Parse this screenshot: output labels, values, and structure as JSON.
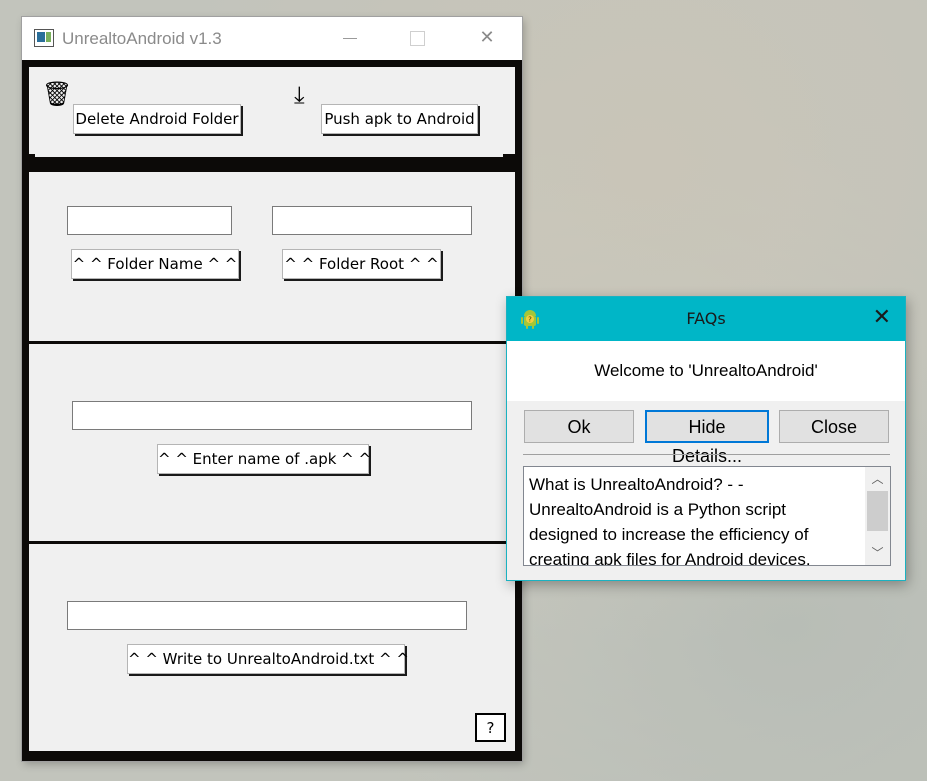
{
  "main_window": {
    "title": "UnrealtoAndroid v1.3",
    "controls": {
      "minimize": "",
      "maximize": "",
      "close": "✕"
    },
    "top_panel": {
      "delete_icon": "🗑",
      "delete_button": "Delete Android Folder",
      "download_icon": "⤓",
      "push_button": "Push apk to Android"
    },
    "folder_panel": {
      "folder_name_value": "",
      "folder_root_value": "",
      "folder_name_button": "^ ^ Folder Name ^ ^",
      "folder_root_button": "^ ^ Folder Root ^ ^"
    },
    "apk_panel": {
      "apk_name_value": "",
      "apk_button": "^ ^ Enter name of .apk ^ ^"
    },
    "write_panel": {
      "write_value": "",
      "write_button": "^ ^ Write to UnrealtoAndroid.txt ^ ^"
    },
    "help_button": "?"
  },
  "faq_dialog": {
    "title": "FAQs",
    "close": "✕",
    "message": "Welcome to 'UnrealtoAndroid'",
    "buttons": {
      "ok": "Ok",
      "hide_details": "Hide Details...",
      "close": "Close"
    },
    "details_text": "What is UnrealtoAndroid? - - UnrealtoAndroid is a Python script designed to increase the efficiency of creating apk files for Android devices.",
    "scroll_up": "︿",
    "scroll_down": "﹀"
  },
  "colors": {
    "faq_titlebar": "#00b6c7",
    "frame": "#0c0a08",
    "panel": "#f0f0f0",
    "focus_border": "#0078d7"
  }
}
